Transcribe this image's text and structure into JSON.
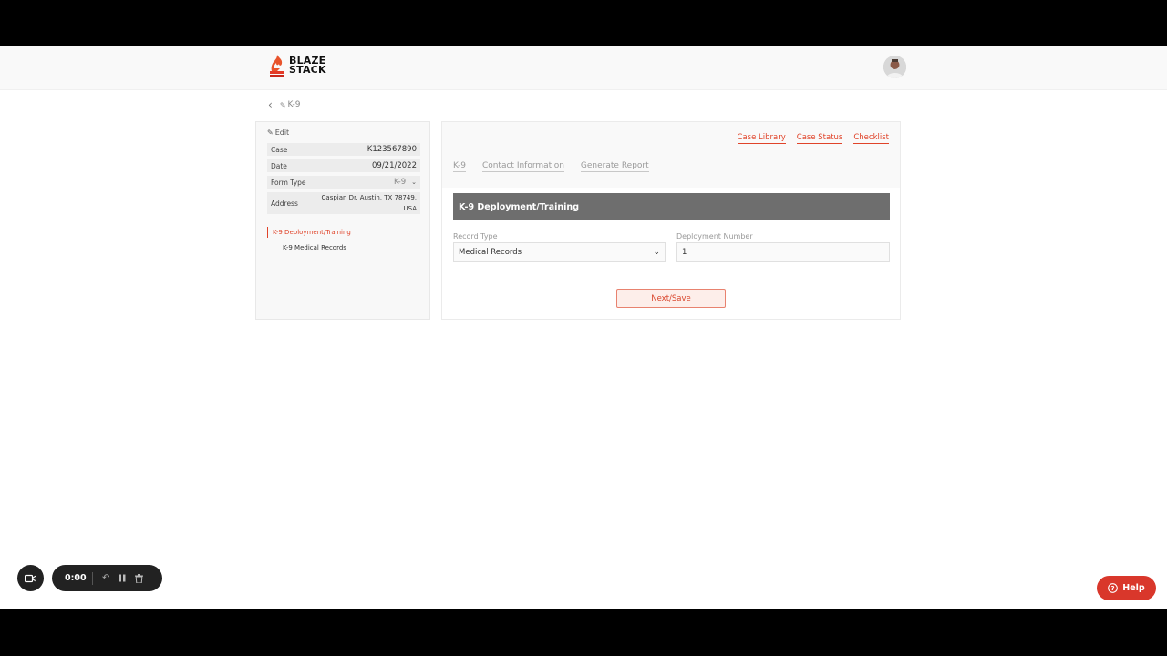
{
  "logo": {
    "line1": "BLAZE",
    "line2": "STACK"
  },
  "breadcrumb": {
    "back_icon": "chevron-left-icon",
    "page_icon": "pencil-icon",
    "label": "K-9"
  },
  "left_panel": {
    "edit_label": "Edit",
    "case": {
      "label": "Case",
      "value": "K123567890"
    },
    "date": {
      "label": "Date",
      "value": "09/21/2022"
    },
    "form_type": {
      "label": "Form Type",
      "value": "K-9"
    },
    "address": {
      "label": "Address",
      "line1": "Caspian Dr. Austin, TX 78749,",
      "line2": "USA"
    },
    "nav": [
      {
        "label": "K-9 Deployment/Training",
        "active": true
      },
      {
        "label": "K-9 Medical Records",
        "active": false
      }
    ]
  },
  "main": {
    "links": [
      "Case Library",
      "Case Status",
      "Checklist"
    ],
    "tabs": [
      "K-9",
      "Contact Information",
      "Generate Report"
    ],
    "section_title": "K-9 Deployment/Training",
    "record_type": {
      "label": "Record Type",
      "value": "Medical Records"
    },
    "deployment_number": {
      "label": "Deployment Number",
      "value": "1"
    },
    "next_button": "Next/Save"
  },
  "recorder": {
    "time": "0:00"
  },
  "help": {
    "label": "Help"
  },
  "colors": {
    "accent": "#e0442a",
    "header_gray": "#6e6e6e",
    "help_red": "#d9372b"
  }
}
